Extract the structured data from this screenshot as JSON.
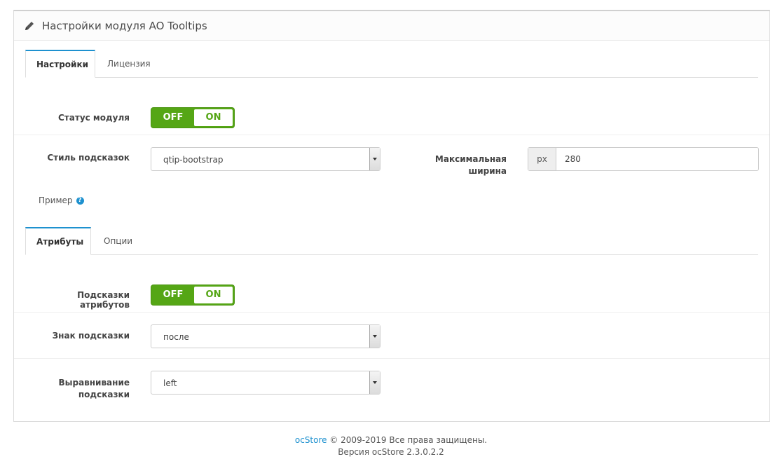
{
  "header": {
    "title": "Настройки модуля AO Tooltips",
    "icon": "pencil-icon"
  },
  "tabs_main": [
    {
      "label": "Настройки"
    },
    {
      "label": "Лицензия"
    }
  ],
  "settings": {
    "status_label": "Статус модуля",
    "toggle_off": "OFF",
    "toggle_on": "ON",
    "style_label": "Стиль подсказок",
    "style_value": "qtip-bootstrap",
    "maxwidth_label_1": "Максимальная",
    "maxwidth_label_2": "ширина",
    "maxwidth_unit": "px",
    "maxwidth_value": "280",
    "example_label": "Пример",
    "help_icon": "question-circle-icon"
  },
  "tabs_sub": [
    {
      "label": "Атрибуты"
    },
    {
      "label": "Опции"
    }
  ],
  "attributes": {
    "hints_label": "Подсказки атрибутов",
    "sign_label": "Знак подсказки",
    "sign_value": "после",
    "align_label_1": "Выравнивание",
    "align_label_2": "подсказки",
    "align_value": "left"
  },
  "footer": {
    "brand": "ocStore",
    "copyright": " © 2009-2019 Все права защищены.",
    "version": "Версия ocStore 2.3.0.2.2"
  },
  "colors": {
    "accent": "#1e91cf",
    "toggle_green": "#55a615"
  }
}
